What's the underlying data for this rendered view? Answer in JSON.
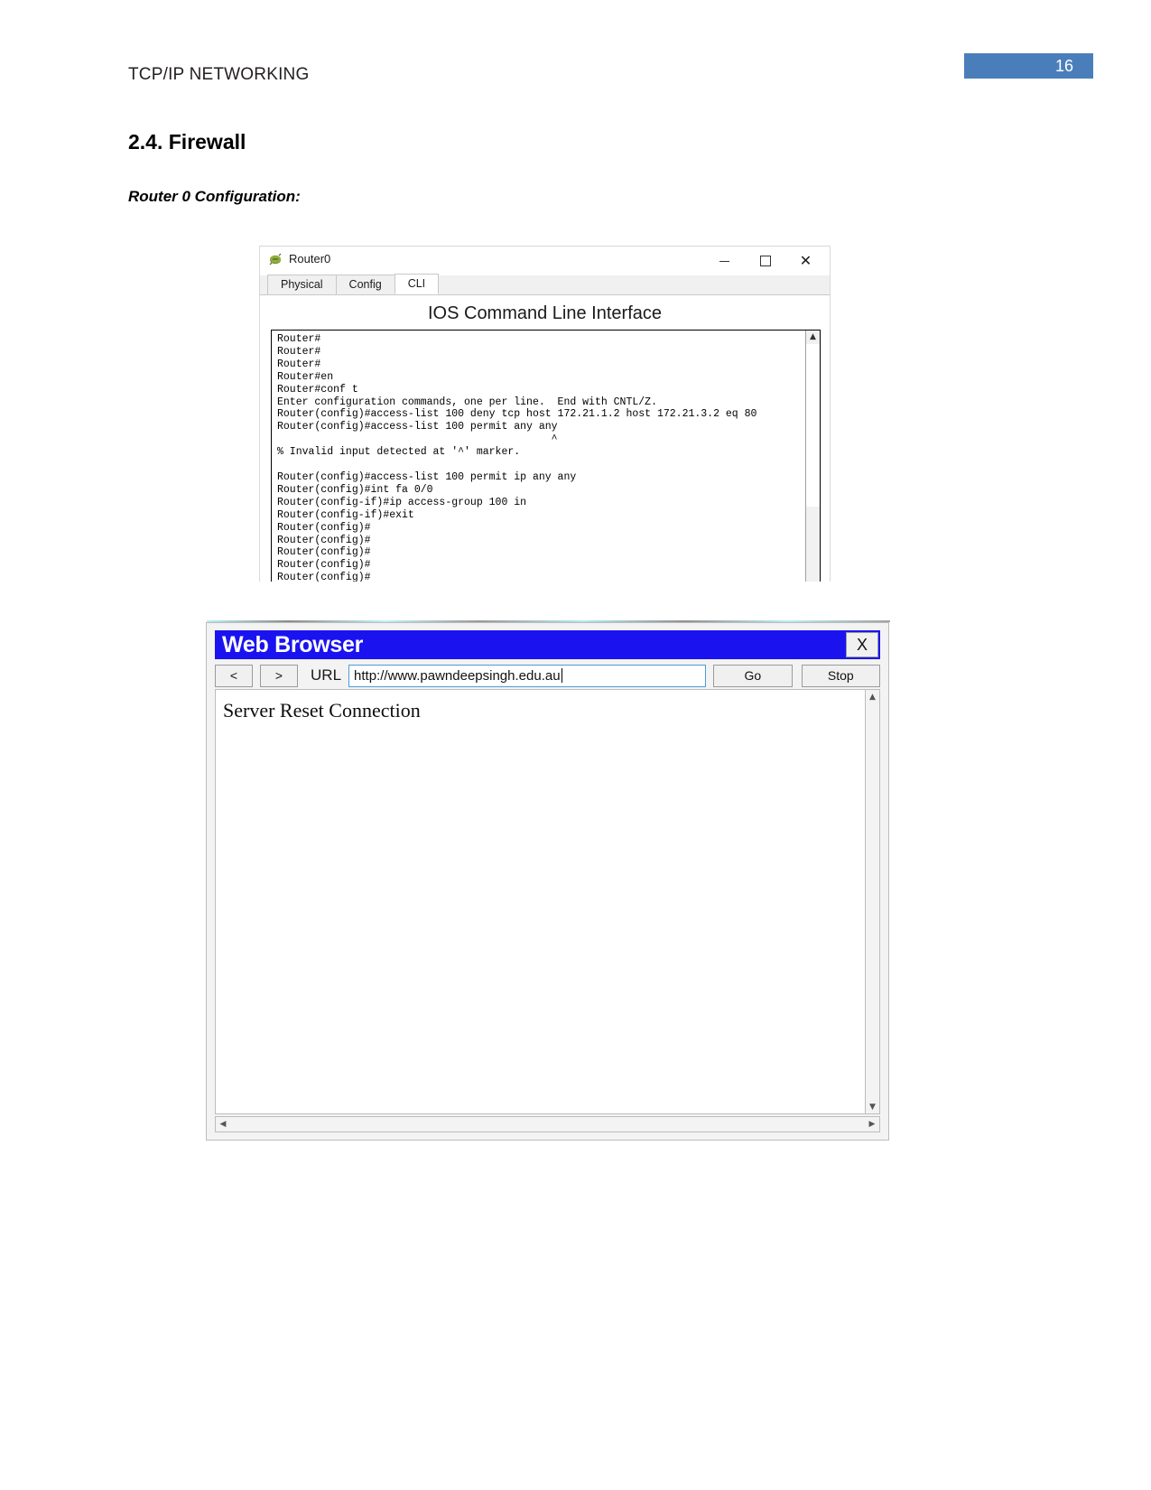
{
  "document": {
    "running_header": "TCP/IP NETWORKING",
    "page_number": "16",
    "page_badge_color": "#4a7ebb",
    "section_title": "2.4. Firewall",
    "subsection_title": "Router 0 Configuration:"
  },
  "router_window": {
    "title": "Router0",
    "icon": "router-device-icon",
    "controls": {
      "minimize": "minimize-icon",
      "maximize": "maximize-icon",
      "close": "✕"
    },
    "tabs": [
      {
        "label": "Physical",
        "active": false
      },
      {
        "label": "Config",
        "active": false
      },
      {
        "label": "CLI",
        "active": true
      }
    ],
    "cli_heading": "IOS Command Line Interface",
    "cli_text": "Router#\nRouter#\nRouter#\nRouter#en\nRouter#conf t\nEnter configuration commands, one per line.  End with CNTL/Z.\nRouter(config)#access-list 100 deny tcp host 172.21.1.2 host 172.21.3.2 eq 80\nRouter(config)#access-list 100 permit any any\n                                            ^\n% Invalid input detected at '^' marker.\n\nRouter(config)#access-list 100 permit ip any any\nRouter(config)#int fa 0/0\nRouter(config-if)#ip access-group 100 in\nRouter(config-if)#exit\nRouter(config)#\nRouter(config)#\nRouter(config)#\nRouter(config)#\nRouter(config)#",
    "scrollbar_up": "▲"
  },
  "browser_window": {
    "title": "Web Browser",
    "title_bar_color": "#1a13f0",
    "close_label": "X",
    "back_label": "<",
    "forward_label": ">",
    "url_label": "URL",
    "url_value": "http://www.pawndeepsingh.edu.au",
    "go_label": "Go",
    "stop_label": "Stop",
    "page_text": "Server Reset Connection",
    "scroll_up": "▲",
    "scroll_down": "▼",
    "scroll_left": "◀",
    "scroll_right": "▶"
  }
}
